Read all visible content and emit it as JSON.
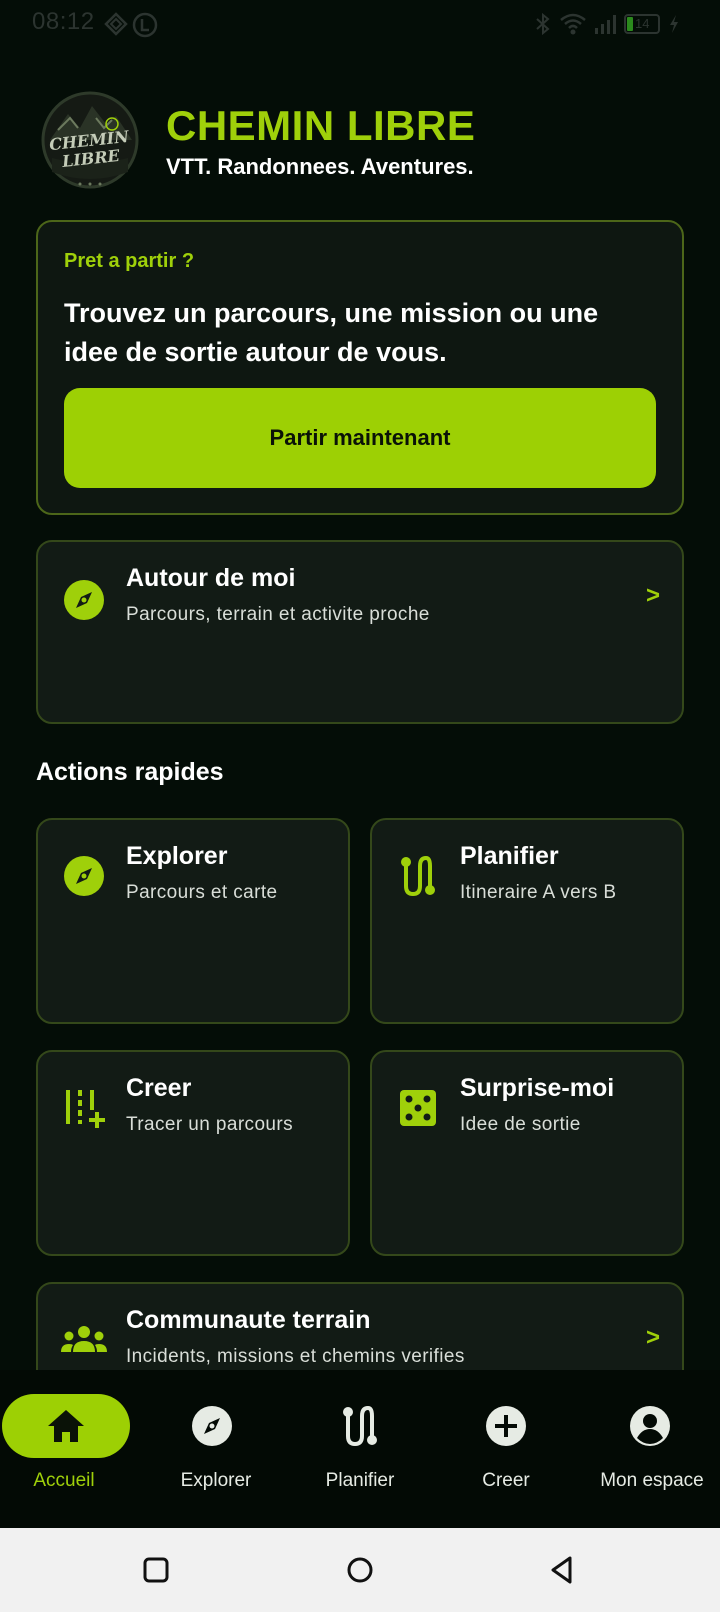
{
  "status_bar": {
    "time": "08:12",
    "battery": "14"
  },
  "header": {
    "logo_text": "CHEMIN LIBRE",
    "title": "CHEMIN LIBRE",
    "tagline": "VTT. Randonnees. Aventures."
  },
  "hero": {
    "eyebrow": "Pret a partir ?",
    "text": "Trouvez un parcours, une mission ou une idee de sortie autour de vous.",
    "button_label": "Partir maintenant"
  },
  "around_me": {
    "title": "Autour de moi",
    "subtitle": "Parcours, terrain et activite proche",
    "chevron": ">",
    "icon": "compass-icon"
  },
  "quick_actions": {
    "title": "Actions rapides",
    "items": [
      {
        "title": "Explorer",
        "subtitle": "Parcours et carte",
        "icon": "compass-icon"
      },
      {
        "title": "Planifier",
        "subtitle": "Itineraire A vers B",
        "icon": "route-icon"
      },
      {
        "title": "Creer",
        "subtitle": "Tracer un parcours",
        "icon": "draw-route-icon"
      },
      {
        "title": "Surprise-moi",
        "subtitle": "Idee de sortie",
        "icon": "dice-icon"
      }
    ]
  },
  "community": {
    "title": "Communaute terrain",
    "subtitle": "Incidents, missions et chemins verifies",
    "chevron": ">",
    "icon": "group-icon"
  },
  "bottom_nav": {
    "items": [
      {
        "label": "Accueil",
        "icon": "home-icon",
        "active": true
      },
      {
        "label": "Explorer",
        "icon": "compass-icon",
        "active": false
      },
      {
        "label": "Planifier",
        "icon": "route-icon",
        "active": false
      },
      {
        "label": "Creer",
        "icon": "add-circle-icon",
        "active": false
      },
      {
        "label": "Mon espace",
        "icon": "account-icon",
        "active": false
      }
    ]
  },
  "colors": {
    "accent": "#9dd004",
    "background": "#040d07",
    "card": "#121b15",
    "card_border": "#34481a"
  }
}
